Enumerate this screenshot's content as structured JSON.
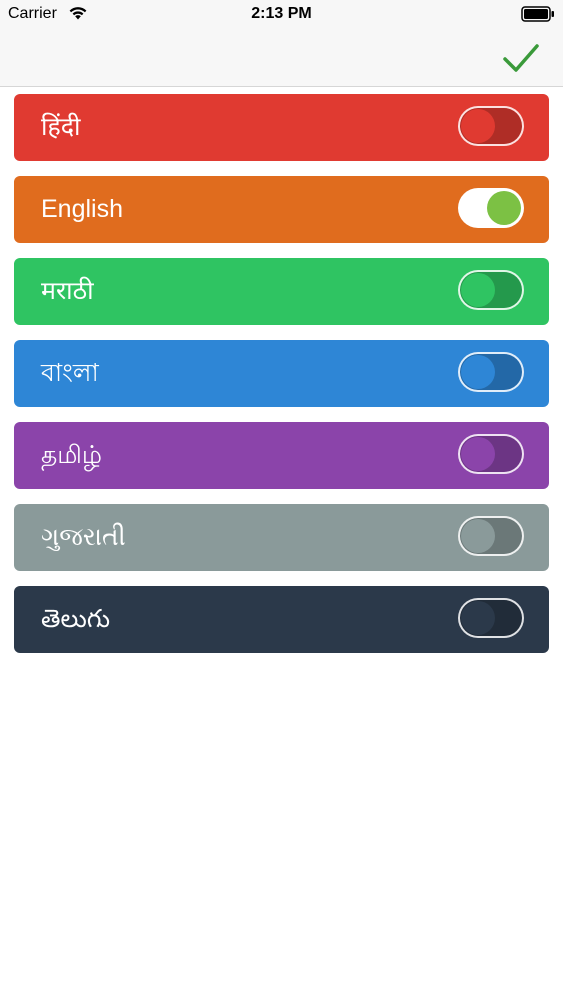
{
  "status_bar": {
    "carrier": "Carrier",
    "time": "2:13 PM",
    "wifi_icon": "wifi-icon",
    "battery_icon": "battery-icon"
  },
  "nav_bar": {
    "done_icon": "checkmark-icon",
    "done_color": "#3a9a3a"
  },
  "languages": [
    {
      "label": "हिंदी",
      "color": "#e03a31",
      "on": false
    },
    {
      "label": "English",
      "color": "#e06c1e",
      "on": true,
      "knob_color": "#7cc144"
    },
    {
      "label": "मराठी",
      "color": "#2fc462",
      "on": false
    },
    {
      "label": "বাংলা",
      "color": "#2e86d6",
      "on": false
    },
    {
      "label": "தமிழ்",
      "color": "#8b44aa",
      "on": false
    },
    {
      "label": "ગુજરાતી",
      "color": "#8a9a9a",
      "on": false
    },
    {
      "label": "తెలుగు",
      "color": "#2b394a",
      "on": false
    }
  ]
}
